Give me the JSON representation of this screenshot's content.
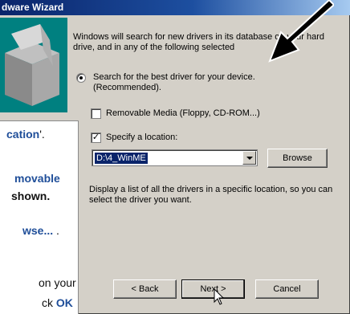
{
  "window": {
    "title": "dware Wizard"
  },
  "intro": "Windows will search for new drivers in its database on your hard drive, and in any of the following selected",
  "radio": {
    "label_line1": "Search for the best driver for your device.",
    "label_line2": "(Recommended).",
    "checked": true
  },
  "options": {
    "removable": {
      "label": "Removable Media (Floppy, CD-ROM...)",
      "checked": false,
      "mark": ""
    },
    "specify": {
      "label": "Specify a location:",
      "checked": true,
      "mark": "✓"
    },
    "display_list": {
      "label": "Display a list of all the drivers in a specific location, so you can select the driver you want.",
      "checked": false,
      "mark": ""
    }
  },
  "location": {
    "value": "D:\\4_WinME"
  },
  "buttons": {
    "browse": "Browse",
    "back": "< Back",
    "next": "Next >",
    "cancel": "Cancel"
  },
  "doc": {
    "line1_blue": "cation",
    "line1_rest": "'.",
    "line2_blue": "movable",
    "line3": "shown.",
    "line4_blue": "wse...",
    "line4_rest": " .",
    "line5": "on your",
    "line6_rest": "ck ",
    "line6_blue": "OK"
  },
  "colors": {
    "titlebar": "#0a246a",
    "face": "#d4d0c8",
    "doc_accent": "#1f4e99"
  },
  "icons": {
    "cursor": "mouse-pointer-icon",
    "callout": "pointer-arrow-icon"
  }
}
